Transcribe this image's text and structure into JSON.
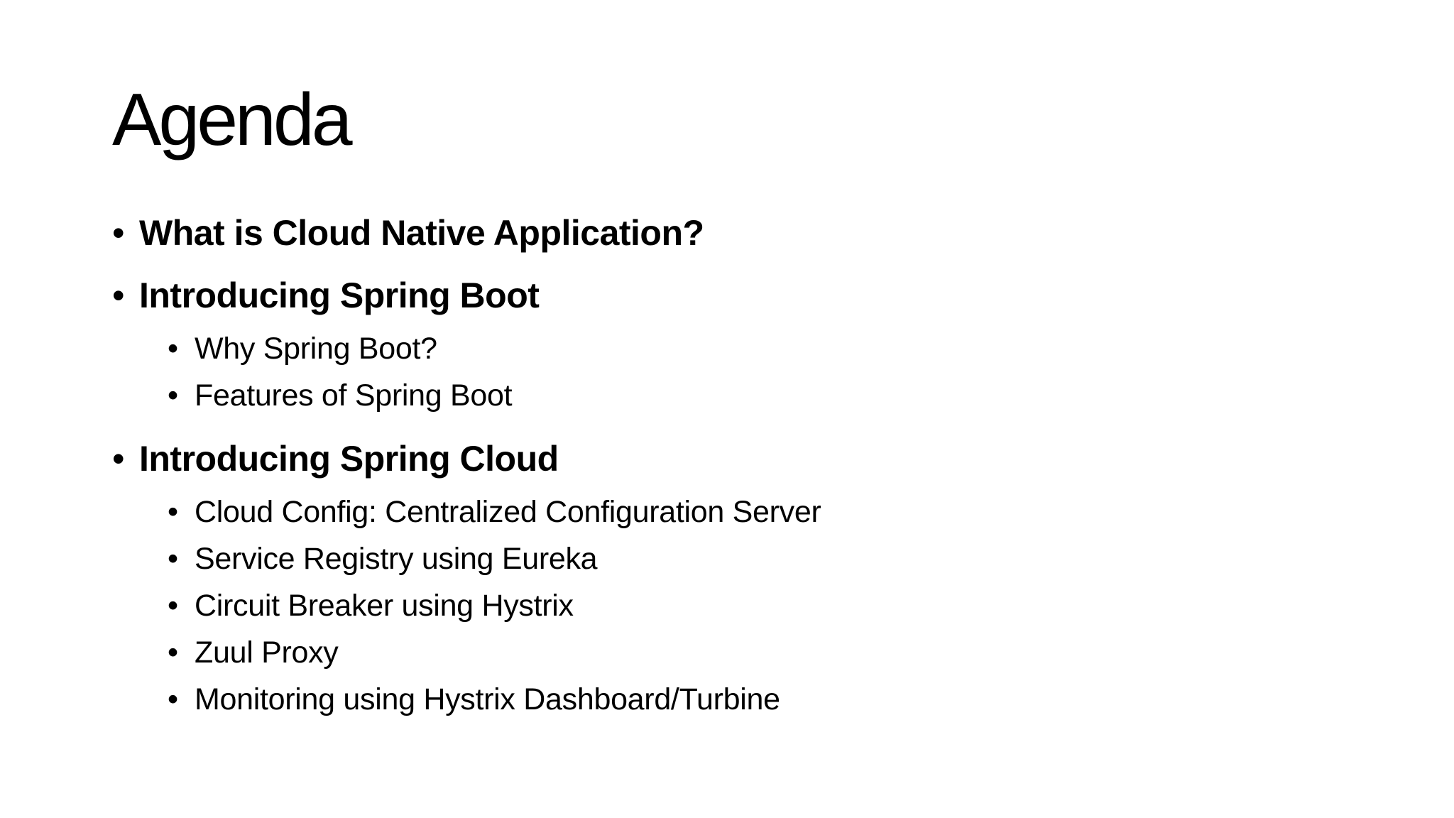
{
  "slide": {
    "title": "Agenda",
    "bullet_glyph": "•",
    "items": [
      {
        "level": 1,
        "text": "What is Cloud Native Application?"
      },
      {
        "level": 1,
        "text": "Introducing Spring Boot"
      },
      {
        "level": 2,
        "text": "Why Spring Boot?"
      },
      {
        "level": 2,
        "text": "Features of Spring Boot"
      },
      {
        "level": 1,
        "text": "Introducing Spring Cloud"
      },
      {
        "level": 2,
        "text": "Cloud Config: Centralized Configuration Server"
      },
      {
        "level": 2,
        "text": "Service Registry using Eureka"
      },
      {
        "level": 2,
        "text": "Circuit Breaker using Hystrix"
      },
      {
        "level": 2,
        "text": "Zuul Proxy"
      },
      {
        "level": 2,
        "text": "Monitoring using Hystrix Dashboard/Turbine"
      }
    ]
  }
}
